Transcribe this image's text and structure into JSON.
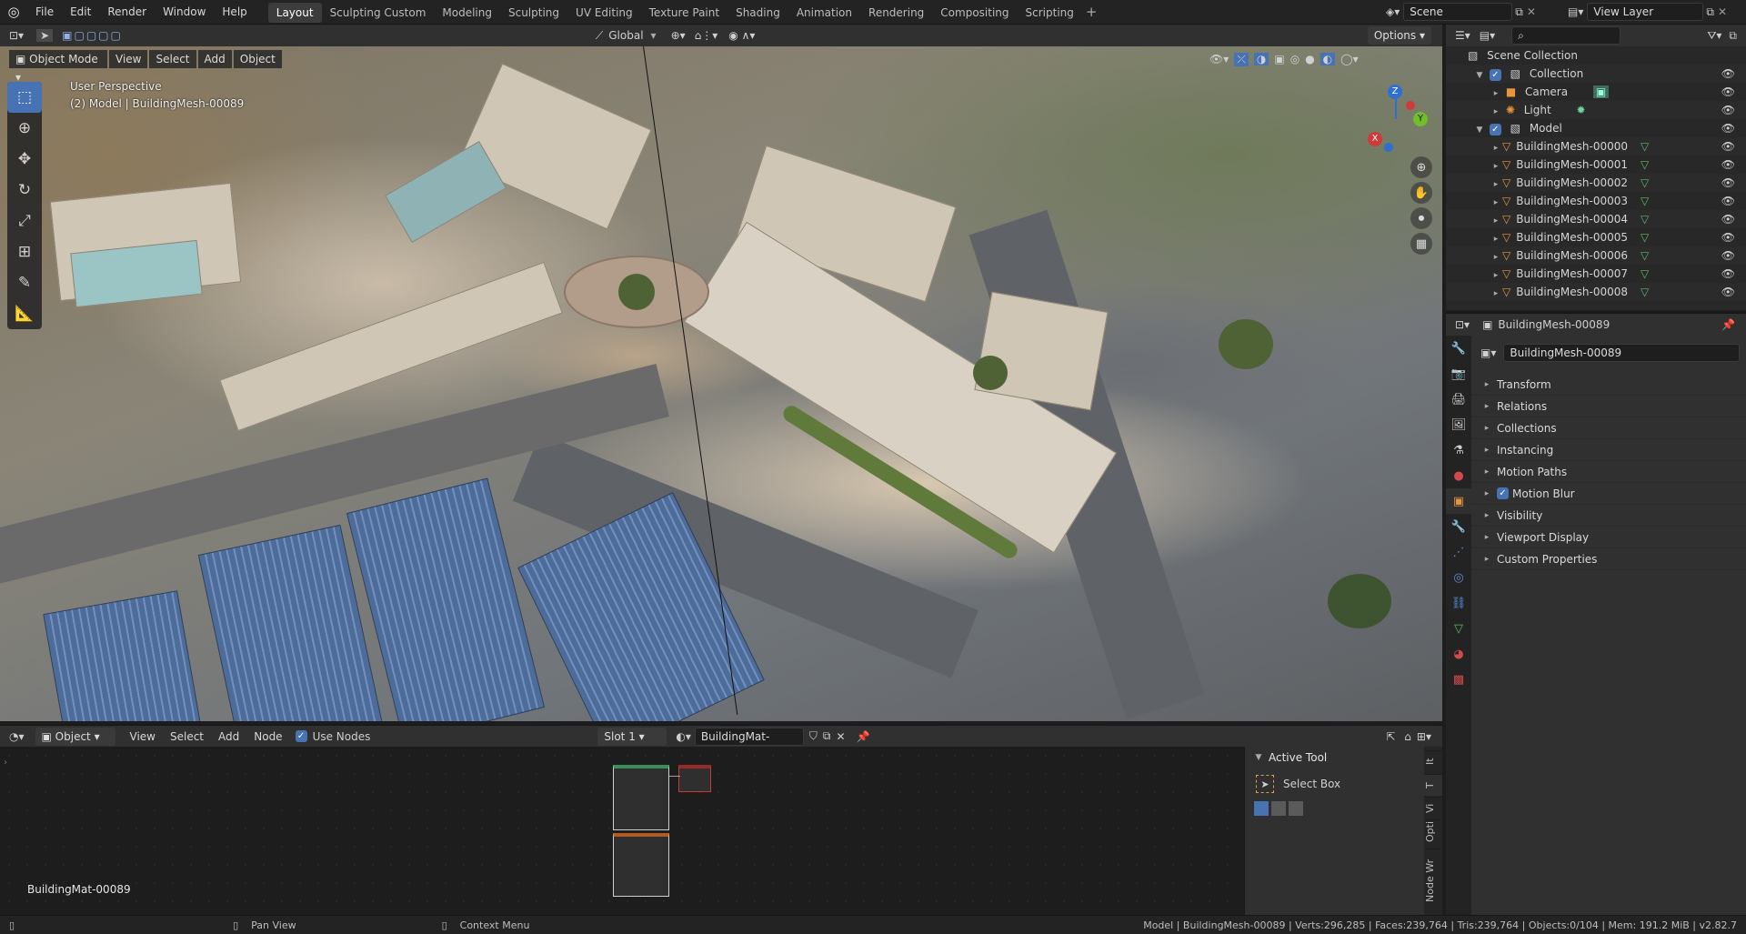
{
  "app": {
    "menu": [
      "File",
      "Edit",
      "Render",
      "Window",
      "Help"
    ],
    "workspaces": [
      "Layout",
      "Sculpting Custom",
      "Modeling",
      "Sculpting",
      "UV Editing",
      "Texture Paint",
      "Shading",
      "Animation",
      "Rendering",
      "Compositing",
      "Scripting"
    ],
    "active_workspace": "Layout",
    "scene": "Scene",
    "view_layer": "View Layer"
  },
  "viewport": {
    "mode": "Object Mode",
    "menus": [
      "View",
      "Select",
      "Add",
      "Object"
    ],
    "orientation": "Global",
    "options": "Options",
    "perspective_label": "User Perspective",
    "object_label": "(2) Model | BuildingMesh-00089",
    "gizmo": {
      "x": "X",
      "y": "Y",
      "z": "Z"
    }
  },
  "node_editor": {
    "type": "Object",
    "menus": [
      "View",
      "Select",
      "Add",
      "Node"
    ],
    "use_nodes_label": "Use Nodes",
    "slot": "Slot 1",
    "material": "BuildingMat-00089",
    "material_caption": "BuildingMat-00089",
    "active_tool_header": "Active Tool",
    "active_tool": "Select Box",
    "tabs": [
      "Node Wr",
      "Opti",
      "Vi",
      "T",
      "It"
    ]
  },
  "outliner": {
    "search_placeholder": "",
    "scene_collection": "Scene Collection",
    "collection": "Collection",
    "camera": "Camera",
    "light": "Light",
    "model": "Model",
    "meshes": [
      "BuildingMesh-00000",
      "BuildingMesh-00001",
      "BuildingMesh-00002",
      "BuildingMesh-00003",
      "BuildingMesh-00004",
      "BuildingMesh-00005",
      "BuildingMesh-00006",
      "BuildingMesh-00007",
      "BuildingMesh-00008"
    ]
  },
  "properties": {
    "header_object": "BuildingMesh-00089",
    "object_name": "BuildingMesh-00089",
    "panels": [
      "Transform",
      "Relations",
      "Collections",
      "Instancing",
      "Motion Paths",
      "Motion Blur",
      "Visibility",
      "Viewport Display",
      "Custom Properties"
    ]
  },
  "statusbar": {
    "pan": "Pan View",
    "context": "Context Menu",
    "stats": "Model | BuildingMesh-00089 | Verts:296,285 | Faces:239,764 | Tris:239,764 | Objects:0/104 | Mem: 191.2 MiB | v2.82.7"
  },
  "colors": {
    "accent": "#4772b3",
    "mesh_icon": "#e8943a",
    "vertex_green": "#5fb86a"
  }
}
